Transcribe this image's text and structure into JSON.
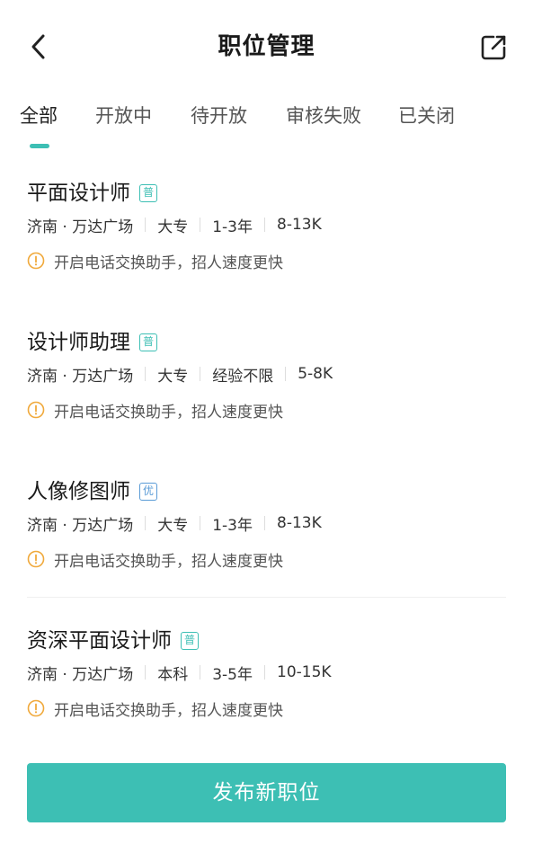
{
  "header": {
    "title": "职位管理",
    "back_icon": "chevron-left-icon",
    "share_icon": "share-export-icon"
  },
  "tabs": [
    {
      "label": "全部",
      "active": true
    },
    {
      "label": "开放中",
      "active": false
    },
    {
      "label": "待开放",
      "active": false
    },
    {
      "label": "审核失败",
      "active": false
    },
    {
      "label": "已关闭",
      "active": false
    }
  ],
  "jobs": [
    {
      "title": "平面设计师",
      "badge": "普",
      "meta": [
        "济南 · 万达广场",
        "大专",
        "1-3年",
        "8-13K"
      ],
      "hint": "开启电话交换助手，招人速度更快"
    },
    {
      "title": "设计师助理",
      "badge": "普",
      "meta": [
        "济南 · 万达广场",
        "大专",
        "经验不限",
        "5-8K"
      ],
      "hint": "开启电话交换助手，招人速度更快"
    },
    {
      "title": "人像修图师",
      "badge": "优",
      "meta": [
        "济南 · 万达广场",
        "大专",
        "1-3年",
        "8-13K"
      ],
      "hint": "开启电话交换助手，招人速度更快"
    },
    {
      "title": "资深平面设计师",
      "badge": "普",
      "meta": [
        "济南 · 万达广场",
        "本科",
        "3-5年",
        "10-15K"
      ],
      "hint": "开启电话交换助手，招人速度更快"
    }
  ],
  "publish_button": {
    "label": "发布新职位"
  },
  "colors": {
    "accent": "#3dbfb4",
    "badge_premium": "#5a9bd6",
    "warning": "#f0a93b"
  }
}
